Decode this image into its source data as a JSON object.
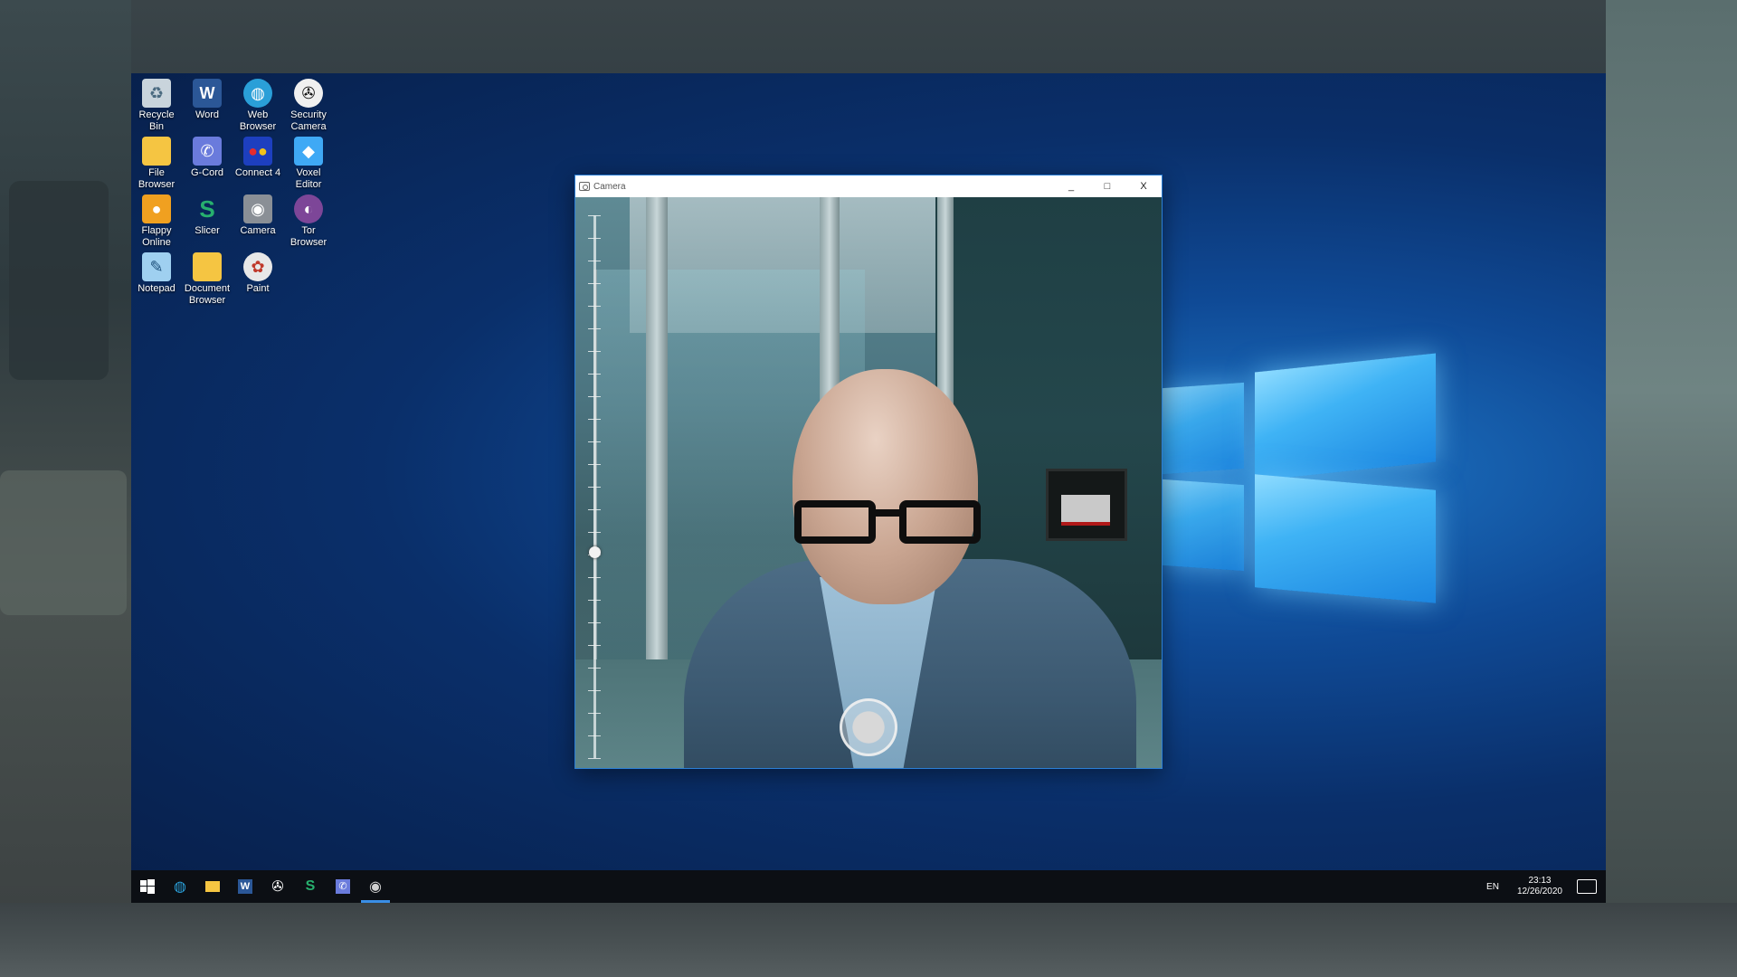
{
  "desktop": {
    "icons": [
      {
        "label": "Recycle Bin",
        "icon": "recycle-bin-icon",
        "color": "#c9d4dc"
      },
      {
        "label": "Word",
        "icon": "word-icon",
        "color": "#2b5797"
      },
      {
        "label": "Web Browser",
        "icon": "web-browser-icon",
        "color": "#2a9fd8"
      },
      {
        "label": "Security Camera",
        "icon": "security-camera-icon",
        "color": "#f0f0f0"
      },
      {
        "label": "File Browser",
        "icon": "folder-icon",
        "color": "#f5c542"
      },
      {
        "label": "G-Cord",
        "icon": "g-cord-icon",
        "color": "#6a7bdc"
      },
      {
        "label": "Connect 4",
        "icon": "connect-4-icon",
        "color": "#d62d2d"
      },
      {
        "label": "Voxel Editor",
        "icon": "voxel-editor-icon",
        "color": "#3fa9f5"
      },
      {
        "label": "Flappy Online",
        "icon": "flappy-bird-icon",
        "color": "#f0a020"
      },
      {
        "label": "Slicer",
        "icon": "slicer-icon",
        "color": "#27b06e"
      },
      {
        "label": "Camera",
        "icon": "camera-icon",
        "color": "#8a8f96"
      },
      {
        "label": "Tor Browser",
        "icon": "tor-browser-icon",
        "color": "#7d4698"
      },
      {
        "label": "Notepad",
        "icon": "notepad-icon",
        "color": "#9fd0f0"
      },
      {
        "label": "Document Browser",
        "icon": "document-browser-icon",
        "color": "#f5c542"
      },
      {
        "label": "Paint",
        "icon": "paint-icon",
        "color": "#e8e8e8"
      }
    ]
  },
  "camera_window": {
    "title": "Camera",
    "minimize_label": "_",
    "maximize_label": "□",
    "close_label": "X",
    "zoom_level": 0.62
  },
  "taskbar": {
    "items": [
      {
        "name": "start-button",
        "icon": "windows-icon"
      },
      {
        "name": "taskbar-web-browser",
        "icon": "web-browser-icon"
      },
      {
        "name": "taskbar-file-browser",
        "icon": "folder-icon"
      },
      {
        "name": "taskbar-word",
        "icon": "word-icon"
      },
      {
        "name": "taskbar-security-camera",
        "icon": "security-camera-icon"
      },
      {
        "name": "taskbar-slicer",
        "icon": "slicer-icon"
      },
      {
        "name": "taskbar-g-cord",
        "icon": "g-cord-icon"
      },
      {
        "name": "taskbar-camera",
        "icon": "camera-icon",
        "active": true
      }
    ],
    "language": "EN",
    "time": "23:13",
    "date": "12/26/2020"
  },
  "colors": {
    "accent": "#3a8ee6",
    "window_border": "#2b7fd6",
    "taskbar": "#0c0f14"
  }
}
